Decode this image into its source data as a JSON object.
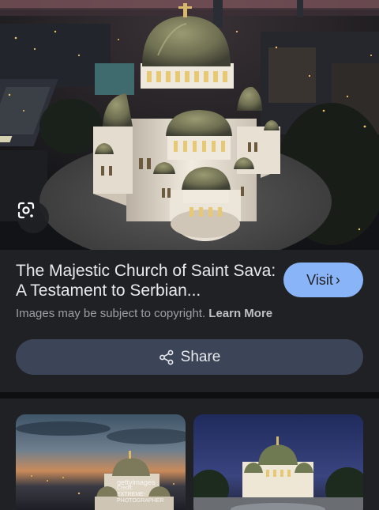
{
  "result": {
    "title": "The Majestic Church of Saint Sava: A Testament to Serbian...",
    "visit_label": "Visit",
    "copyright_text": "Images may be subject to copyright.",
    "learn_more_label": "Learn More",
    "share_label": "Share"
  },
  "icons": {
    "lens": "google-lens-icon",
    "visit_chevron": "chevron-right-icon",
    "share": "share-icon"
  },
  "related": {
    "items": [
      {
        "watermark_1": "gettyimages",
        "watermark_2": "Credit:",
        "watermark_3": "EXTREME-PHOTOGRAPHER"
      },
      {}
    ]
  },
  "colors": {
    "background": "#202124",
    "accent": "#8ab4f8",
    "share_button": "#3c4458",
    "muted_text": "#9aa0a6"
  }
}
